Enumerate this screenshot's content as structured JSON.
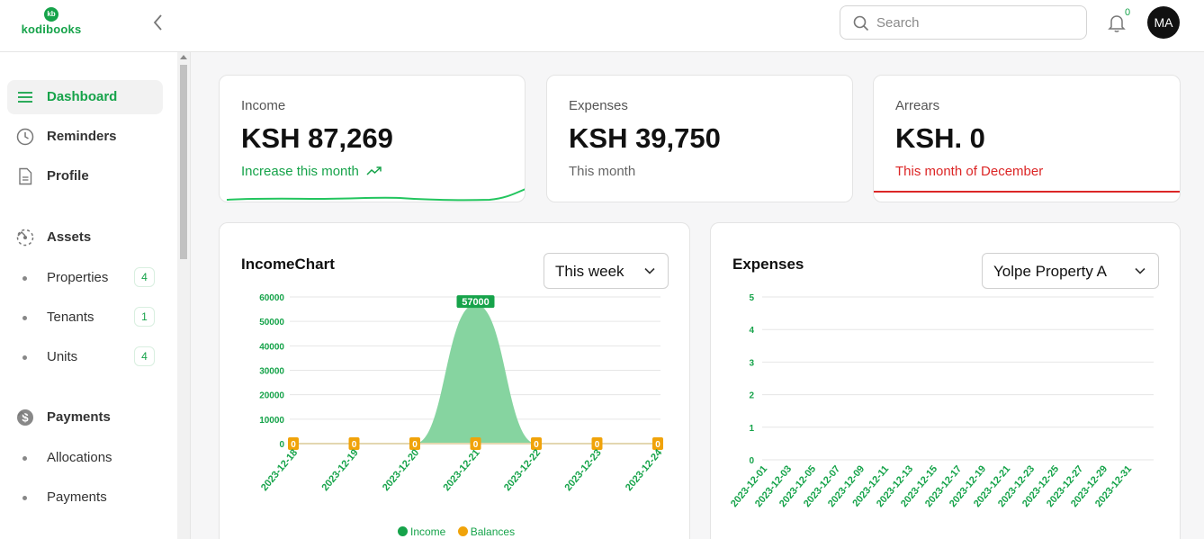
{
  "header": {
    "logo_mark": "kb",
    "logo_text": "kodibooks",
    "search_placeholder": "Search",
    "notification_count": "0",
    "avatar_initials": "MA"
  },
  "sidebar": {
    "items": [
      {
        "label": "Dashboard",
        "icon": "menu-icon",
        "active": true
      },
      {
        "label": "Reminders",
        "icon": "clock-icon"
      },
      {
        "label": "Profile",
        "icon": "document-icon"
      }
    ],
    "sections": [
      {
        "label": "Assets",
        "icon": "assets-icon",
        "expanded": true,
        "children": [
          {
            "label": "Properties",
            "count": "4"
          },
          {
            "label": "Tenants",
            "count": "1"
          },
          {
            "label": "Units",
            "count": "4"
          }
        ]
      },
      {
        "label": "Payments",
        "icon": "dollar-icon",
        "expanded": true,
        "children": [
          {
            "label": "Allocations"
          },
          {
            "label": "Payments"
          }
        ]
      }
    ]
  },
  "stats": {
    "income": {
      "title": "Income",
      "value": "KSH 87,269",
      "note": "Increase this month"
    },
    "expenses": {
      "title": "Expenses",
      "value": "KSH 39,750",
      "note": "This month"
    },
    "arrears": {
      "title": "Arrears",
      "value": "KSH. 0",
      "note": "This month of December"
    }
  },
  "income_panel": {
    "title": "IncomeChart",
    "period_select": "This week",
    "legend": [
      "Income",
      "Balances"
    ]
  },
  "expenses_panel": {
    "title": "Expenses",
    "property_select": "Yolpe Property A"
  },
  "colors": {
    "accent": "#16a34a",
    "income_fill": "#86d4a0",
    "balances": "#f0a30a",
    "danger": "#dc2626"
  },
  "chart_data": [
    {
      "type": "area",
      "categories": [
        "2023-12-18",
        "2023-12-19",
        "2023-12-20",
        "2023-12-21",
        "2023-12-22",
        "2023-12-23",
        "2023-12-24"
      ],
      "series": [
        {
          "name": "Income",
          "values": [
            0,
            0,
            0,
            57000,
            0,
            0,
            0
          ],
          "peak_label": "57000"
        },
        {
          "name": "Balances",
          "values": [
            0,
            0,
            0,
            0,
            0,
            0,
            0
          ],
          "labels": [
            "0",
            "0",
            "0",
            "0",
            "0",
            "0",
            "0"
          ]
        }
      ],
      "yticks": [
        "0",
        "10000",
        "20000",
        "30000",
        "40000",
        "50000",
        "60000"
      ],
      "ylim": [
        0,
        60000
      ],
      "grid": true
    },
    {
      "type": "line",
      "categories": [
        "2023-12-01",
        "2023-12-03",
        "2023-12-05",
        "2023-12-07",
        "2023-12-09",
        "2023-12-11",
        "2023-12-13",
        "2023-12-15",
        "2023-12-17",
        "2023-12-19",
        "2023-12-21",
        "2023-12-23",
        "2023-12-25",
        "2023-12-27",
        "2023-12-29",
        "2023-12-31"
      ],
      "yticks": [
        "0",
        "1",
        "2",
        "3",
        "4",
        "5"
      ],
      "ylim": [
        0,
        5
      ],
      "grid": true
    }
  ]
}
